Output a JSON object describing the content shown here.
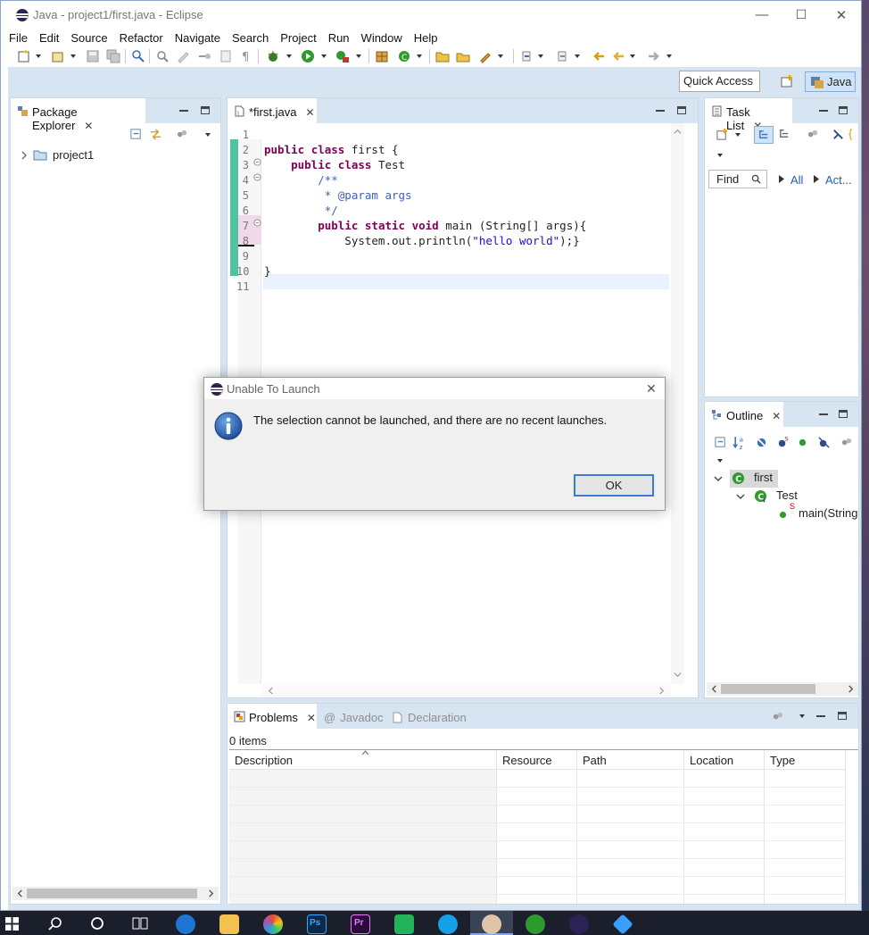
{
  "window": {
    "title": "Java - project1/first.java - Eclipse",
    "caption_buttons": {
      "minimize": "—",
      "maximize": "☐",
      "close": "✕"
    }
  },
  "menu": [
    "File",
    "Edit",
    "Source",
    "Refactor",
    "Navigate",
    "Search",
    "Project",
    "Run",
    "Window",
    "Help"
  ],
  "perspective": {
    "quick_access": "Quick Access",
    "active": "Java"
  },
  "package_explorer": {
    "tab_label": "Package Explorer",
    "tree": [
      {
        "label": "project1"
      }
    ]
  },
  "editor": {
    "tab_label": "*first.java",
    "line_numbers": [
      "1",
      "2",
      "3",
      "4",
      "5",
      "6",
      "7",
      "8",
      "9",
      "10",
      "11"
    ],
    "lines": [
      {
        "tokens": []
      },
      {
        "tokens": [
          {
            "t": "kw",
            "v": "public"
          },
          {
            "t": "sp",
            "v": " "
          },
          {
            "t": "kw",
            "v": "class"
          },
          {
            "t": "sp",
            "v": " first {"
          }
        ]
      },
      {
        "tokens": [
          {
            "t": "sp",
            "v": "    "
          },
          {
            "t": "kw",
            "v": "public"
          },
          {
            "t": "sp",
            "v": " "
          },
          {
            "t": "kw",
            "v": "class"
          },
          {
            "t": "sp",
            "v": " Test"
          }
        ]
      },
      {
        "tokens": [
          {
            "t": "sp",
            "v": "        "
          },
          {
            "t": "cm",
            "v": "/**"
          }
        ]
      },
      {
        "tokens": [
          {
            "t": "cm",
            "v": "         * @param args"
          }
        ]
      },
      {
        "tokens": [
          {
            "t": "cm",
            "v": "         */"
          }
        ]
      },
      {
        "tokens": [
          {
            "t": "sp",
            "v": "        "
          },
          {
            "t": "kw",
            "v": "public"
          },
          {
            "t": "sp",
            "v": " "
          },
          {
            "t": "kw",
            "v": "static"
          },
          {
            "t": "sp",
            "v": " "
          },
          {
            "t": "kw",
            "v": "void"
          },
          {
            "t": "sp",
            "v": " main (String[] args){"
          }
        ]
      },
      {
        "tokens": [
          {
            "t": "sp",
            "v": "            System.out.println("
          },
          {
            "t": "str",
            "v": "\"hello world\""
          },
          {
            "t": "sp",
            "v": ");}"
          }
        ]
      },
      {
        "tokens": []
      },
      {
        "tokens": [
          {
            "t": "sp",
            "v": "}"
          }
        ]
      },
      {
        "tokens": []
      }
    ],
    "fold_markers": [
      "3",
      "4",
      "7"
    ]
  },
  "task_list": {
    "tab_label": "Task List",
    "find_placeholder": "Find",
    "filter_all": "All",
    "filter_activate": "Act..."
  },
  "outline": {
    "tab_label": "Outline",
    "tree": [
      {
        "label": "first",
        "level": 0
      },
      {
        "label": "Test",
        "level": 1
      },
      {
        "label": "main(String",
        "level": 2,
        "modifier": "S"
      }
    ]
  },
  "bottom_panel": {
    "tabs": [
      "Problems",
      "Javadoc",
      "Declaration"
    ],
    "active_tab": "Problems",
    "items_count": "0 items",
    "columns": [
      "Description",
      "Resource",
      "Path",
      "Location",
      "Type"
    ]
  },
  "dialog": {
    "title": "Unable To Launch",
    "message": "The selection cannot be launched, and there are no recent launches.",
    "ok_label": "OK",
    "close_symbol": "✕"
  },
  "colors": {
    "accent": "#3b7bd1",
    "keyword": "#7f0055",
    "comment": "#3f5fbf",
    "string": "#2a00ff",
    "change_bar": "#53c2a0"
  }
}
